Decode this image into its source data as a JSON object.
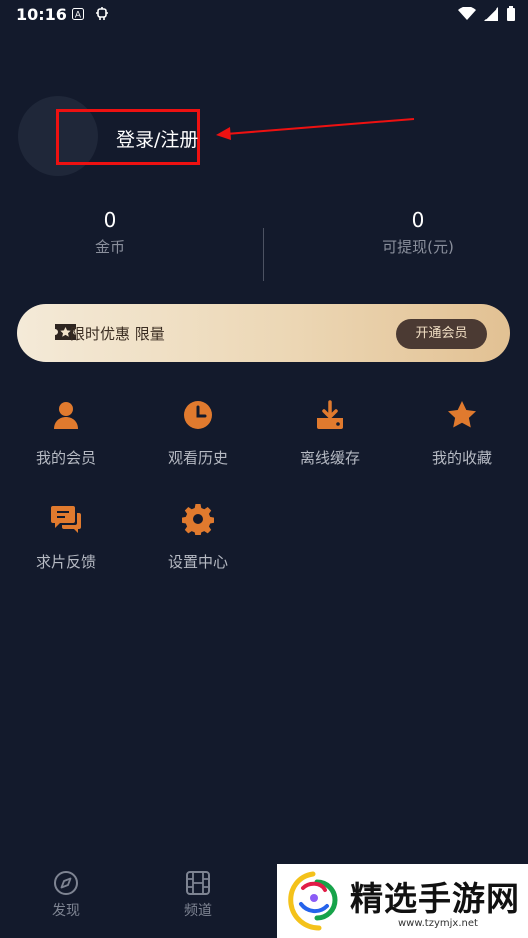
{
  "status_bar": {
    "time": "10:16"
  },
  "profile": {
    "login_label": "登录/注册"
  },
  "stats": [
    {
      "value": "0",
      "label": "金币"
    },
    {
      "value": "0",
      "label": "可提现(元)"
    }
  ],
  "vip": {
    "promo_text": "限时优惠 限量",
    "button_label": "开通会员"
  },
  "menu": [
    {
      "label": "我的会员",
      "icon": "person-icon"
    },
    {
      "label": "观看历史",
      "icon": "clock-icon"
    },
    {
      "label": "离线缓存",
      "icon": "download-icon"
    },
    {
      "label": "我的收藏",
      "icon": "star-icon"
    },
    {
      "label": "求片反馈",
      "icon": "chat-icon"
    },
    {
      "label": "设置中心",
      "icon": "gear-icon"
    }
  ],
  "bottom_nav": [
    {
      "label": "发现",
      "icon": "compass-icon"
    },
    {
      "label": "频道",
      "icon": "film-icon"
    }
  ],
  "watermark": {
    "text": "精选手游网",
    "url": "www.tzymjx.net"
  },
  "colors": {
    "background": "#131a2c",
    "accent": "#e07a2e",
    "vip_button": "#4b3a33"
  }
}
